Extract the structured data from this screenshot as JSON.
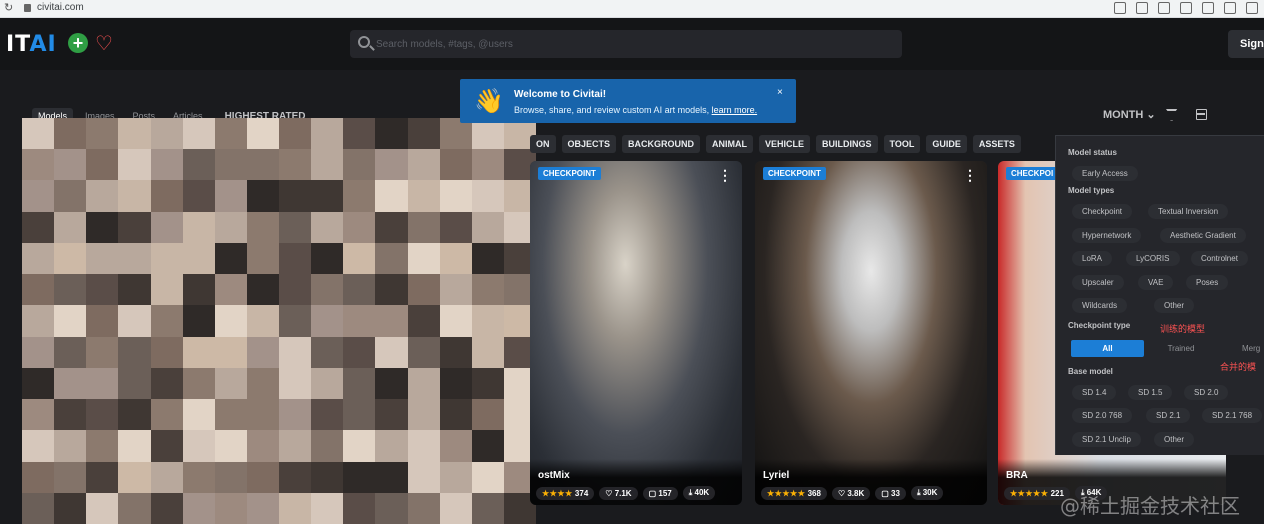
{
  "browser": {
    "url": "civitai.com"
  },
  "header": {
    "logo_main": "IT",
    "logo_ai": "AI",
    "search_placeholder": "Search models, #tags, @users",
    "signin_label": "Sign"
  },
  "welcome": {
    "title": "Welcome to Civitai!",
    "body": "Browse, share, and review custom AI art models, ",
    "link": "learn more.",
    "close": "×"
  },
  "subnav": {
    "tabs": [
      "Models",
      "Images",
      "Posts",
      "Articles"
    ],
    "sort": "HIGHEST RATED"
  },
  "controls": {
    "period": "MONTH"
  },
  "tags": [
    "ON",
    "OBJECTS",
    "BACKGROUND",
    "ANIMAL",
    "VEHICLE",
    "BUILDINGS",
    "TOOL",
    "GUIDE",
    "ASSETS"
  ],
  "cards": [
    {
      "badge": "CHECKPOINT",
      "name": "ostMix",
      "stars": "★★★★",
      "rating": "374",
      "likes": "7.1K",
      "comments": "157",
      "downloads": "40K"
    },
    {
      "badge": "CHECKPOINT",
      "name": "Lyriel",
      "stars": "★★★★★",
      "rating": "368",
      "likes": "3.8K",
      "comments": "33",
      "downloads": "30K"
    },
    {
      "badge": "CHECKPOI",
      "name": "BRA",
      "stars": "★★★★★",
      "rating": "221",
      "likes": "",
      "comments": "",
      "downloads": "64K"
    }
  ],
  "filters": {
    "model_status_label": "Model status",
    "model_status": [
      "Early Access"
    ],
    "model_types_label": "Model types",
    "model_types": [
      "Checkpoint",
      "Textual Inversion",
      "Hypernetwork",
      "Aesthetic Gradient",
      "LoRA",
      "LyCORIS",
      "Controlnet",
      "Upscaler",
      "VAE",
      "Poses",
      "Wildcards",
      "Other"
    ],
    "checkpoint_type_label": "Checkpoint type",
    "checkpoint_types": [
      "All",
      "Trained",
      "Merg"
    ],
    "base_model_label": "Base model",
    "base_models": [
      "SD 1.4",
      "SD 1.5",
      "SD 2.0",
      "SD 2.0 768",
      "SD 2.1",
      "SD 2.1 768",
      "SD 2.1 Unclip",
      "Other"
    ]
  },
  "annotations": {
    "trained": "训练的模型",
    "merged": "合并的模"
  },
  "watermark": "@稀土掘金技术社区"
}
